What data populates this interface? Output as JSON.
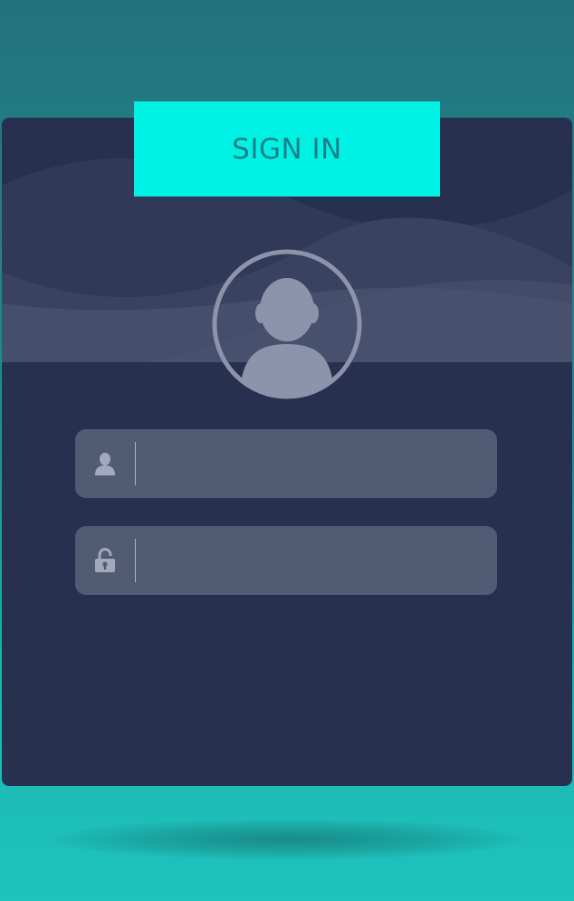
{
  "login_form": {
    "title": "SIGN IN",
    "username": {
      "icon": "user-icon",
      "value": "",
      "placeholder": ""
    },
    "password": {
      "icon": "lock-icon",
      "value": "",
      "placeholder": ""
    }
  },
  "colors": {
    "background_top": "#23727c",
    "background_bottom": "#1ec3bd",
    "card": "#27304f",
    "accent": "#00f2e4",
    "title_text": "#1a7f86",
    "field": "#525b74",
    "icon": "#8d93ab"
  }
}
